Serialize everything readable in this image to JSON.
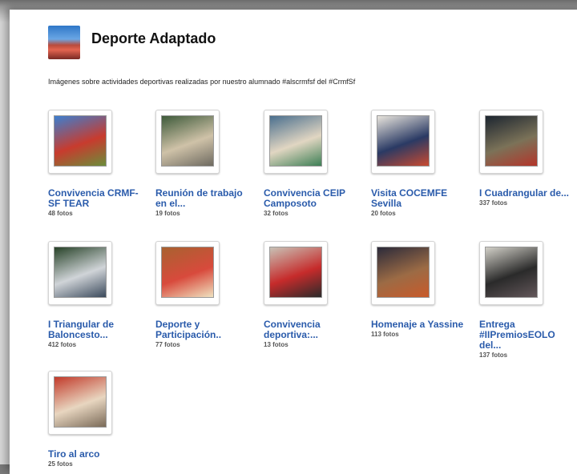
{
  "header": {
    "title": "Deporte Adaptado",
    "description": "Imágenes sobre actividades deportivas realizadas por nuestro alumnado #alscrmfsf del #CrmfSf"
  },
  "albums": [
    {
      "title": "Convivencia CRMF-SF TEAR",
      "count": "48 fotos",
      "colors": [
        "#3c7fd0",
        "#c83b2e",
        "#6b8e3a"
      ]
    },
    {
      "title": "Reunión de trabajo en el...",
      "count": "19 fotos",
      "colors": [
        "#3d5a3a",
        "#cfc2a8",
        "#6e6a60"
      ]
    },
    {
      "title": "Convivencia CEIP Camposoto",
      "count": "32 fotos",
      "colors": [
        "#4a6f8e",
        "#e1d6c2",
        "#3d7f55"
      ]
    },
    {
      "title": "Visita COCEMFE Sevilla",
      "count": "20 fotos",
      "colors": [
        "#e9e5dd",
        "#2a3a64",
        "#c94a30"
      ]
    },
    {
      "title": "I Cuadrangular de...",
      "count": "337 fotos",
      "colors": [
        "#1c2530",
        "#7b7258",
        "#b4352a"
      ]
    },
    {
      "title": "I Triangular de Baloncesto...",
      "count": "412 fotos",
      "colors": [
        "#274228",
        "#d0d4d8",
        "#3b4a5c"
      ]
    },
    {
      "title": "Deporte y Participación..",
      "count": "77 fotos",
      "colors": [
        "#a86230",
        "#d84a3c",
        "#efe2c0"
      ]
    },
    {
      "title": "Convivencia deportiva:...",
      "count": "13 fotos",
      "colors": [
        "#c8c2b6",
        "#c62b2b",
        "#2b2b2b"
      ]
    },
    {
      "title": "Homenaje a Yassine",
      "count": "113 fotos",
      "colors": [
        "#2b2a3a",
        "#9c6b45",
        "#c95a2a"
      ]
    },
    {
      "title": "Entrega #IIPremiosEOLO del...",
      "count": "137 fotos",
      "colors": [
        "#d2d0c8",
        "#2a2a2a",
        "#63575a"
      ]
    },
    {
      "title": "Tiro al arco",
      "count": "25 fotos",
      "colors": [
        "#c23a2a",
        "#e8d6c0",
        "#7a6a58"
      ]
    }
  ]
}
